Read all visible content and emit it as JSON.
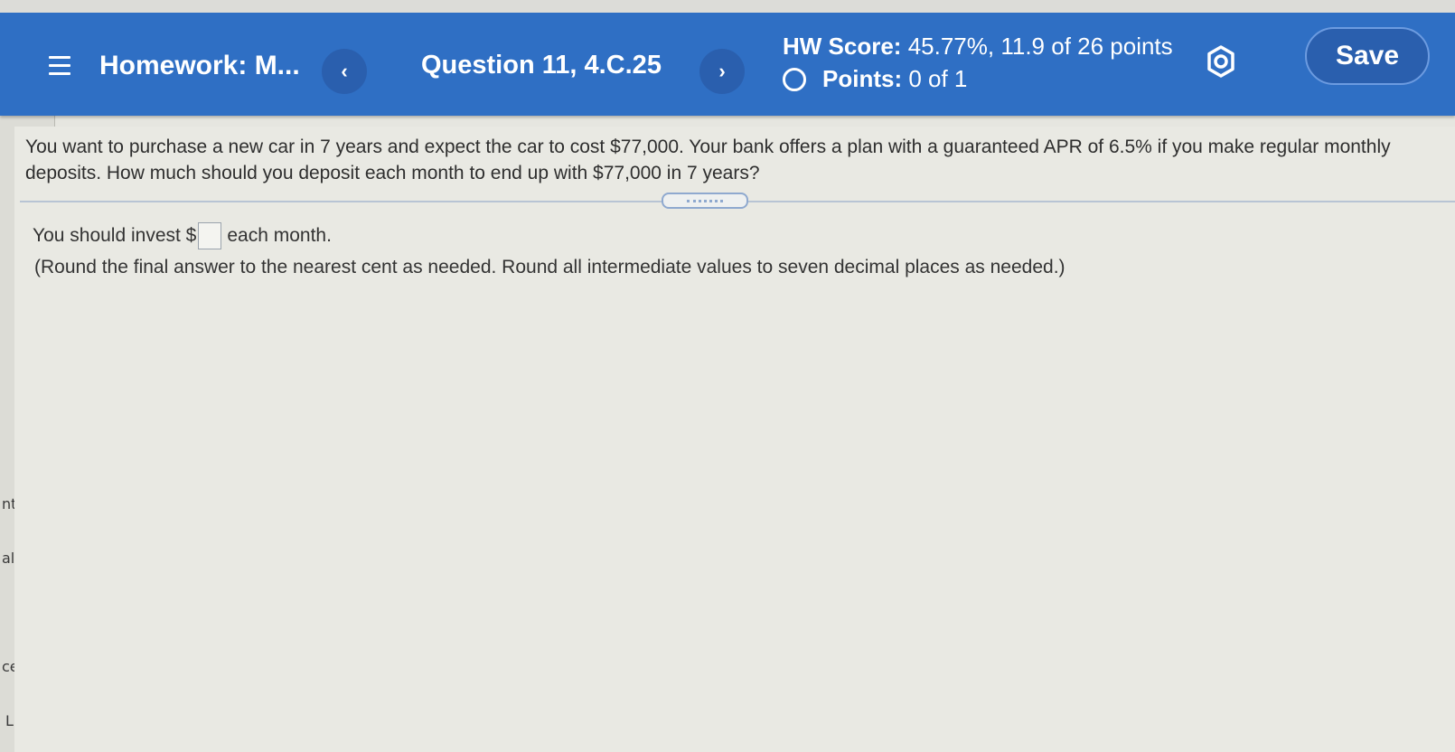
{
  "header": {
    "title": "Homework: M...",
    "prev_icon": "‹",
    "question_label": "Question 11, 4.C.25",
    "next_icon": "›",
    "hw_score_label": "HW Score:",
    "hw_score_value": "45.77%, 11.9 of 26 points",
    "points_label": "Points:",
    "points_value": "0 of 1",
    "save_label": "Save",
    "accent_color": "#2f6fc4"
  },
  "question": {
    "text": "You want to purchase a new car in 7 years and expect the car to cost $77,000. Your bank offers a plan with a guaranteed APR of 6.5% if you make regular monthly deposits. How much should you deposit each month to end up with $77,000 in 7 years?",
    "answer_prefix": "You should invest $",
    "answer_value": "",
    "answer_suffix": "each month.",
    "rounding_note": "(Round the final answer to the nearest cent as needed. Round all intermediate values to seven decimal places as needed.)"
  },
  "left_rail": {
    "items": [
      "nts",
      "al",
      "cess",
      "Library"
    ]
  }
}
